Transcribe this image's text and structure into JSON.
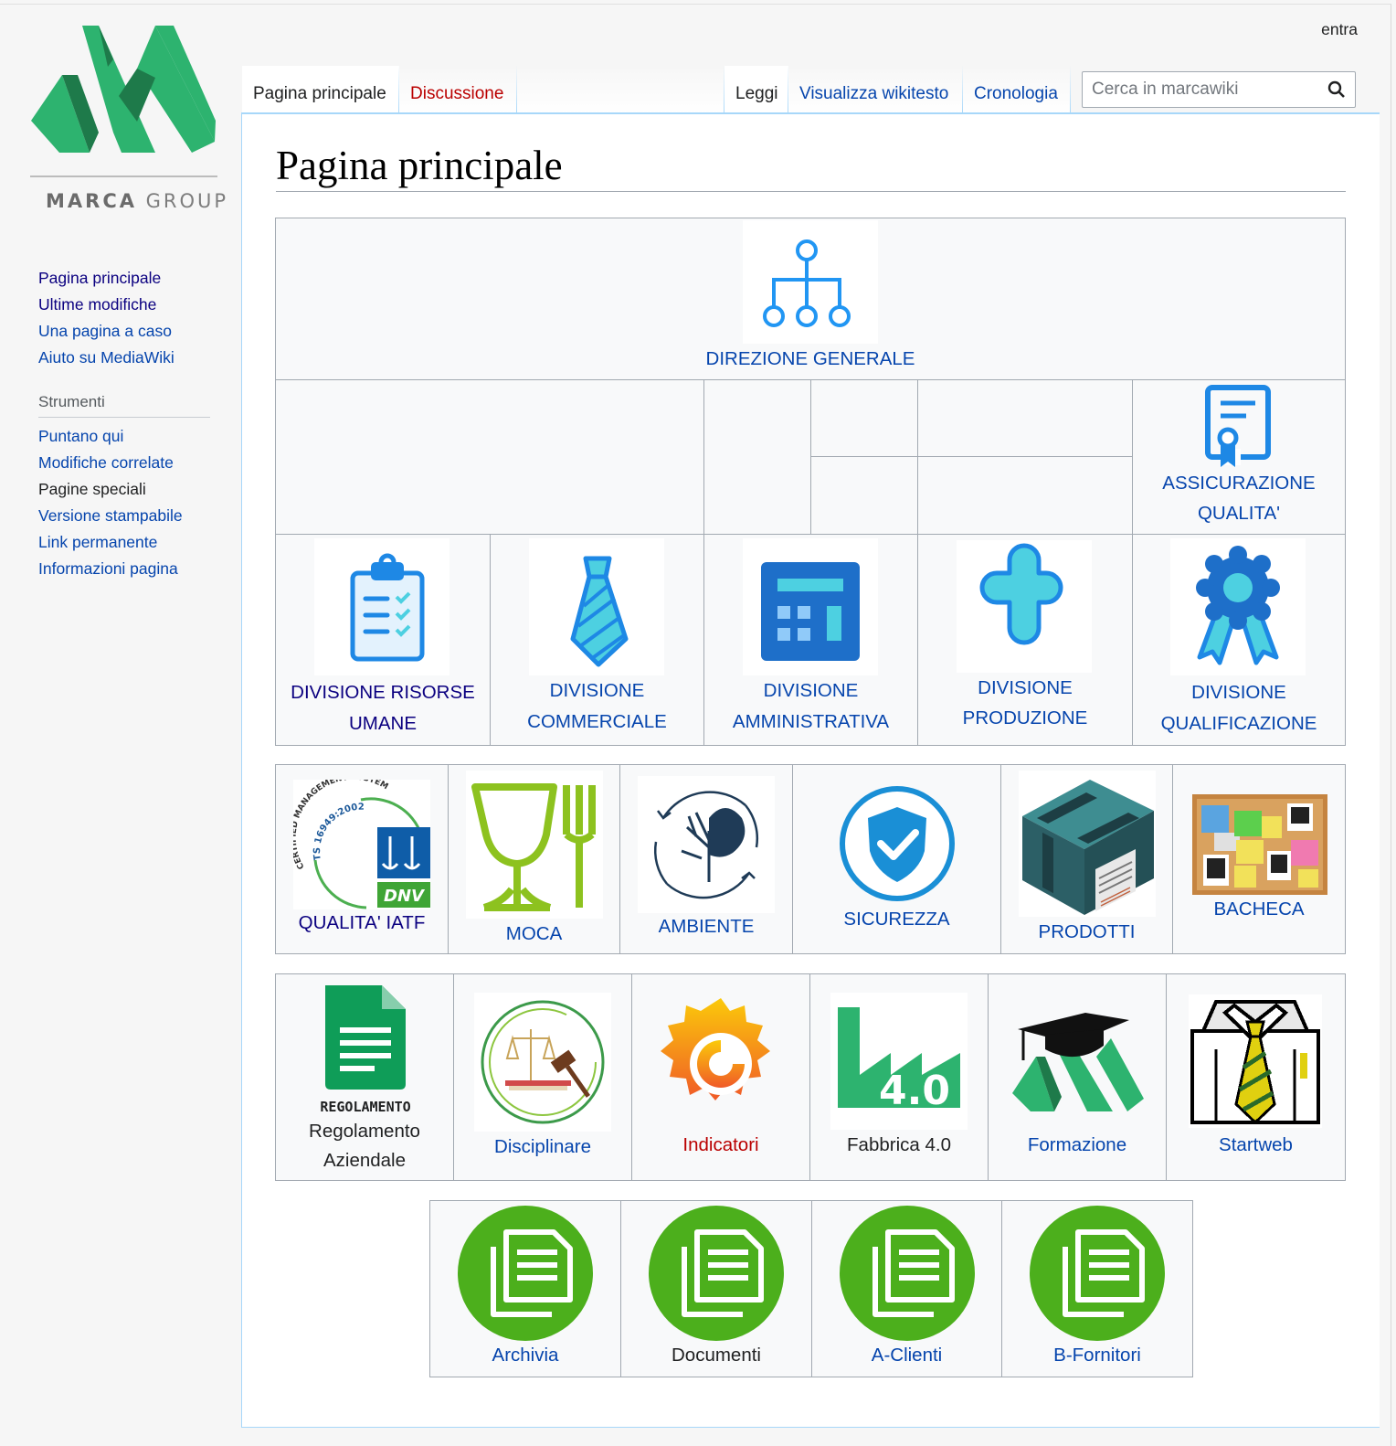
{
  "logo": {
    "text_bold": "MARCA",
    "text_light": " GROUP"
  },
  "header": {
    "login": "entra"
  },
  "tabs": {
    "page": "Pagina principale",
    "discussion": "Discussione",
    "read": "Leggi",
    "source": "Visualizza wikitesto",
    "history": "Cronologia"
  },
  "search": {
    "placeholder": "Cerca in marcawiki"
  },
  "sidebar": {
    "nav": [
      "Pagina principale",
      "Ultime modifiche",
      "Una pagina a caso",
      "Aiuto su MediaWiki"
    ],
    "tools_heading": "Strumenti",
    "tools": [
      "Puntano qui",
      "Modifiche correlate",
      "Pagine speciali",
      "Versione stampabile",
      "Link permanente",
      "Informazioni pagina"
    ]
  },
  "page": {
    "title": "Pagina principale"
  },
  "org": {
    "top": "DIREZIONE GENERALE",
    "qa": [
      "ASSICURAZIONE",
      "QUALITA'"
    ],
    "divisions": [
      [
        "DIVISIONE RISORSE",
        "UMANE"
      ],
      [
        "DIVISIONE",
        "COMMERCIALE"
      ],
      [
        "DIVISIONE",
        "AMMINISTRATIVA"
      ],
      [
        "DIVISIONE",
        "PRODUZIONE"
      ],
      [
        "DIVISIONE",
        "QUALIFICAZIONE"
      ]
    ]
  },
  "row2": [
    "QUALITA' IATF",
    "MOCA",
    "AMBIENTE",
    "SICUREZZA",
    "PRODOTTI",
    "BACHECA"
  ],
  "badge": {
    "top": "CERTIFIED MANAGEMENT SYSTEM",
    "std": "TS 16949:2002",
    "brand": "DNV"
  },
  "row3": {
    "reg_caption": "REGOLAMENTO",
    "labels": [
      [
        "Regolamento",
        "Aziendale"
      ],
      [
        "Disciplinare"
      ],
      [
        "Indicatori"
      ],
      [
        "Fabbrica 4.0"
      ],
      [
        "Formazione"
      ],
      [
        "Startweb"
      ]
    ],
    "fab_text": "4.0"
  },
  "row4": [
    "Archivia",
    "Documenti",
    "A-Clienti",
    "B-Fornitori"
  ],
  "colors": {
    "link": "#0645ad",
    "visited": "#0b0080",
    "new": "#ba0000",
    "logo_green": "#2db36f",
    "doc_green": "#4caf1c"
  }
}
